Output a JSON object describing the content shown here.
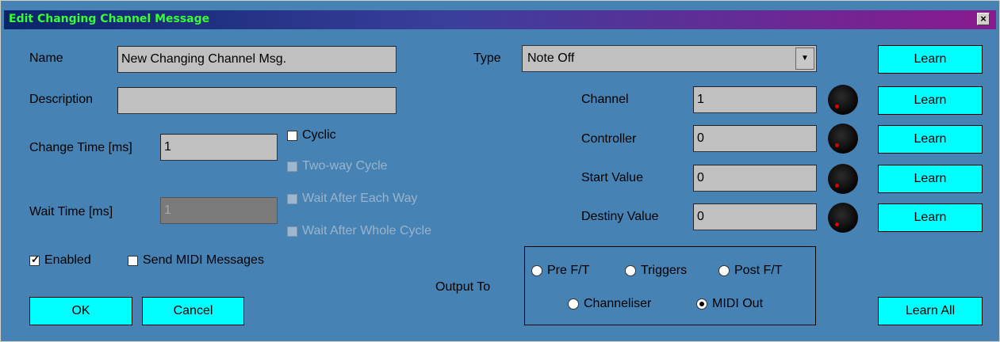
{
  "window": {
    "title": "Edit Changing Channel Message",
    "close": "×"
  },
  "name": {
    "label": "Name",
    "value": "New Changing Channel Msg."
  },
  "description": {
    "label": "Description",
    "value": ""
  },
  "change_time": {
    "label": "Change Time [ms]",
    "value": "1"
  },
  "wait_time": {
    "label": "Wait Time [ms]",
    "value": "1"
  },
  "options": {
    "cyclic": "Cyclic",
    "two_way": "Two-way Cycle",
    "wait_each": "Wait After Each Way",
    "wait_whole": "Wait After Whole Cycle"
  },
  "enabled": {
    "label": "Enabled",
    "checked": true
  },
  "send_midi": {
    "label": "Send MIDI Messages",
    "checked": false
  },
  "buttons": {
    "ok": "OK",
    "cancel": "Cancel",
    "learn": "Learn",
    "learn_all": "Learn All"
  },
  "type": {
    "label": "Type",
    "value": "Note Off"
  },
  "channel": {
    "label": "Channel",
    "value": "1"
  },
  "controller": {
    "label": "Controller",
    "value": "0"
  },
  "start_value": {
    "label": "Start Value",
    "value": "0"
  },
  "destiny_value": {
    "label": "Destiny Value",
    "value": "0"
  },
  "output": {
    "label": "Output To",
    "options": [
      "Pre F/T",
      "Triggers",
      "Post F/T",
      "Channeliser",
      "MIDI Out"
    ],
    "selected": "MIDI Out"
  },
  "colors": {
    "background": "#4682b4",
    "button": "#00ffff",
    "title_text": "#33ff33"
  }
}
